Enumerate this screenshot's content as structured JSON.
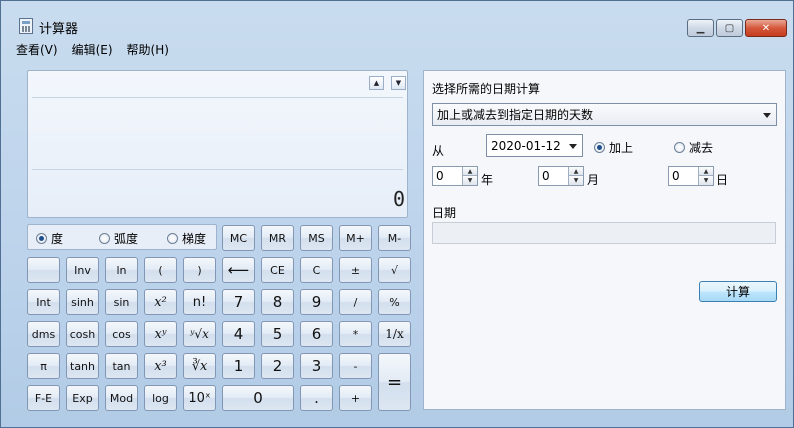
{
  "window": {
    "title": "计算器"
  },
  "menu": [
    "查看(V)",
    "编辑(E)",
    "帮助(H)"
  ],
  "display": {
    "value": "0"
  },
  "angle_modes": [
    {
      "label": "度",
      "selected": true
    },
    {
      "label": "弧度",
      "selected": false
    },
    {
      "label": "梯度",
      "selected": false
    }
  ],
  "memory_buttons": [
    "MC",
    "MR",
    "MS",
    "M+",
    "M-"
  ],
  "keys": {
    "inv": "Inv",
    "ln": "ln",
    "lparen": "(",
    "rparen": ")",
    "backspace": "⟵",
    "ce": "CE",
    "c": "C",
    "plusminus": "±",
    "sqrt": "√",
    "int": "Int",
    "sinh": "sinh",
    "sin": "sin",
    "x2": "x²",
    "nfact": "n!",
    "n7": "7",
    "n8": "8",
    "n9": "9",
    "div": "/",
    "percent": "%",
    "dms": "dms",
    "cosh": "cosh",
    "cos": "cos",
    "xy": "xʸ",
    "yroot": "ʸ√x",
    "n4": "4",
    "n5": "5",
    "n6": "6",
    "mul": "*",
    "recip": "1/x",
    "pi": "π",
    "tanh": "tanh",
    "tan": "tan",
    "x3": "x³",
    "cuberoot": "∛x",
    "n1": "1",
    "n2": "2",
    "n3": "3",
    "sub": "-",
    "fe": "F-E",
    "exp": "Exp",
    "mod": "Mod",
    "log": "log",
    "tenx": "10ˣ",
    "n0": "0",
    "dot": ".",
    "add": "+",
    "eq": "="
  },
  "date_panel": {
    "heading": "选择所需的日期计算",
    "mode": "加上或减去到指定日期的天数",
    "from_label": "从",
    "from_date": "2020-01-12",
    "add_label": "加上",
    "subtract_label": "减去",
    "add_selected": true,
    "years": "0",
    "years_label": "年",
    "months": "0",
    "months_label": "月",
    "days": "0",
    "days_label": "日",
    "result_label": "日期",
    "result_value": "",
    "calculate_label": "计算"
  }
}
